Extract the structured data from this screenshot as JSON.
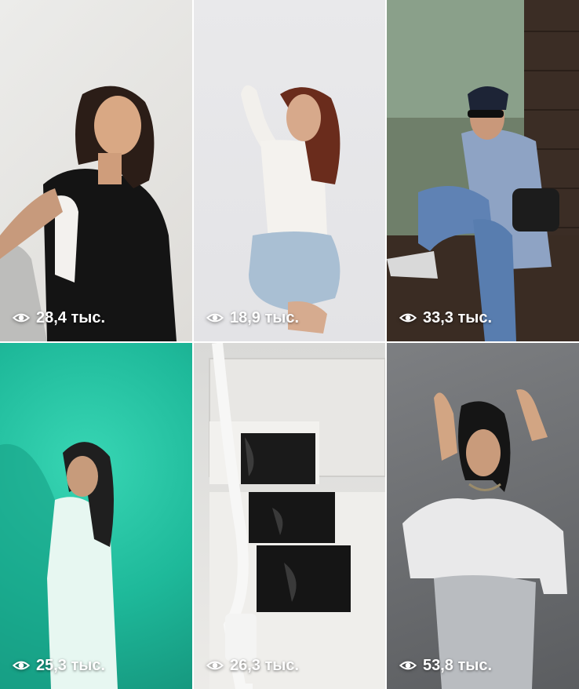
{
  "tiles": [
    {
      "views": "28,4 тыс.",
      "icon": "eye-icon"
    },
    {
      "views": "18,9 тыс.",
      "icon": "eye-icon"
    },
    {
      "views": "33,3 тыс.",
      "icon": "eye-icon"
    },
    {
      "views": "25,3 тыс.",
      "icon": "eye-icon"
    },
    {
      "views": "26,3 тыс.",
      "icon": "eye-icon"
    },
    {
      "views": "53,8 тыс.",
      "icon": "eye-icon"
    }
  ]
}
